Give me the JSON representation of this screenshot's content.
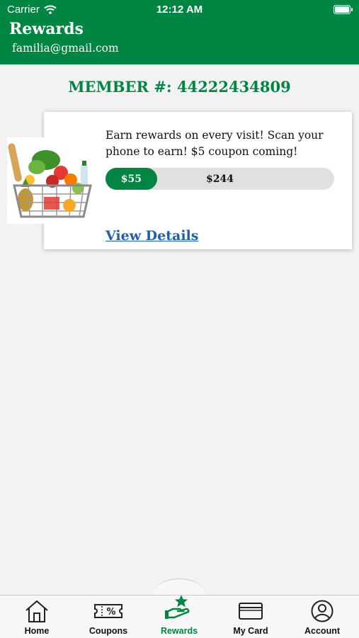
{
  "status_bar": {
    "carrier": "Carrier",
    "time": "12:12 AM"
  },
  "header": {
    "title": "Rewards",
    "email": "familia@gmail.com"
  },
  "member": {
    "label": "MEMBER #:",
    "number": "44222434809"
  },
  "reward_card": {
    "description": "Earn rewards on every visit! Scan your phone to earn! $5 coupon coming!",
    "progress_current": "$55",
    "progress_goal": "$244",
    "progress_fraction": 0.225,
    "link": "View Details",
    "image": "grocery-basket"
  },
  "tabs": [
    {
      "label": "Home",
      "icon": "home-icon",
      "active": false
    },
    {
      "label": "Coupons",
      "icon": "coupon-icon",
      "active": false
    },
    {
      "label": "Rewards",
      "icon": "rewards-icon",
      "active": true
    },
    {
      "label": "My Card",
      "icon": "card-icon",
      "active": false
    },
    {
      "label": "Account",
      "icon": "account-icon",
      "active": false
    }
  ],
  "colors": {
    "brand_green": "#008542",
    "link_blue": "#1f5fa8",
    "background": "#f2f2f2"
  }
}
